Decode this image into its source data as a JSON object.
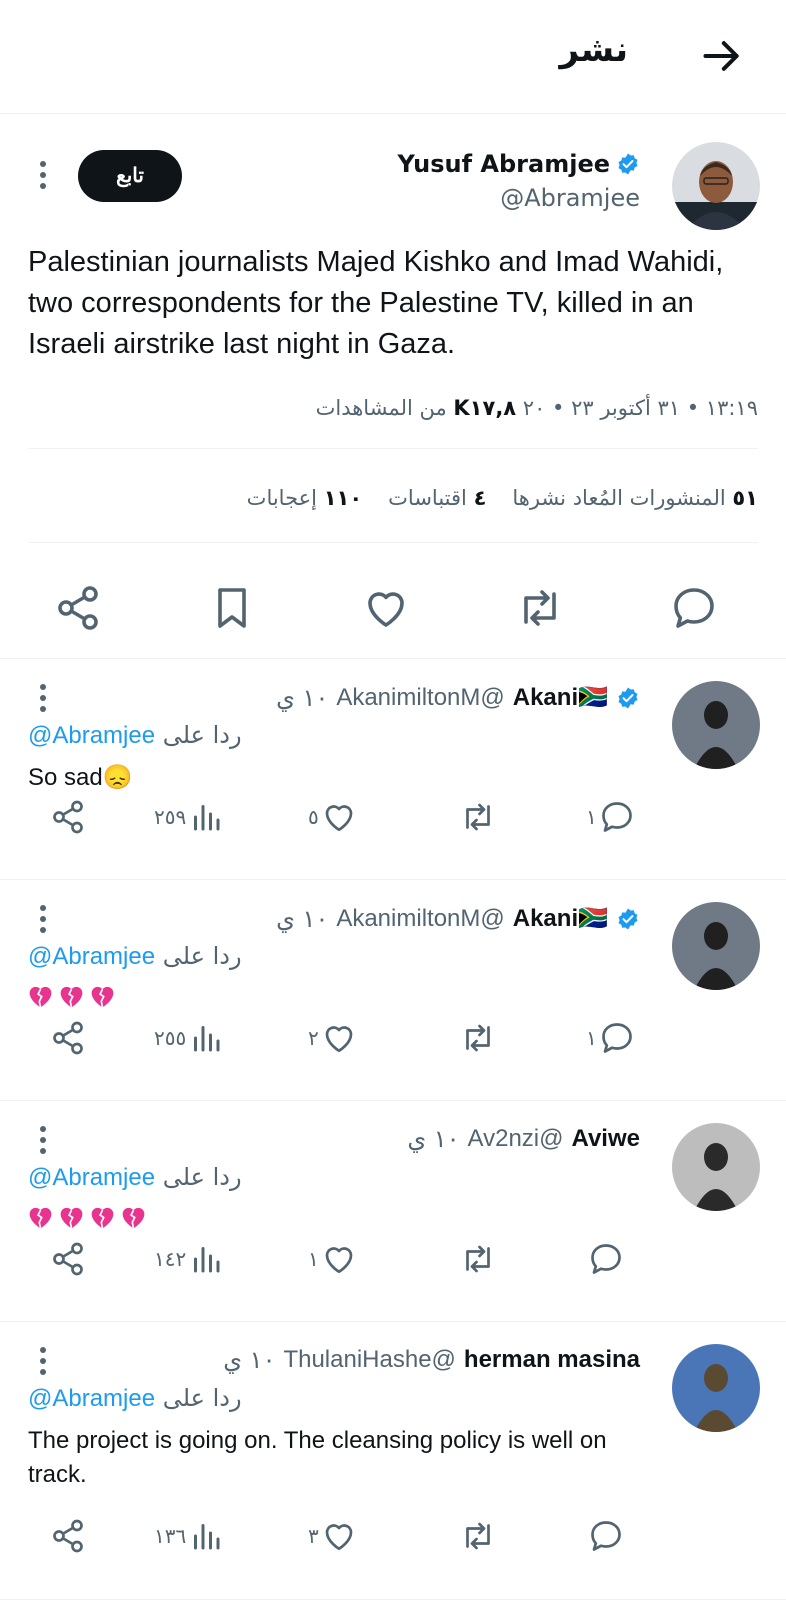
{
  "header": {
    "title": "نشر",
    "back_icon": "arrow-right-icon"
  },
  "tweet": {
    "author_name": "Yusuf Abramjee",
    "author_handle": "@Abramjee",
    "follow_label": "تابع",
    "text": "Palestinian journalists Majed Kishko and Imad Wahidi, two correspondents for the Palestine TV, killed in an Israeli airstrike last night in Gaza.",
    "timestamp": "١٣:١٩ • ٣١ أكتوبر ٢٣ • ٢٠",
    "views_count": "K١٧,٨",
    "views_label": "من المشاهدات",
    "reposts_count": "٥١",
    "reposts_label": "المنشورات المُعاد نشرها",
    "quotes_count": "٤",
    "quotes_label": "اقتباسات",
    "likes_count": "١١٠",
    "likes_label": "إعجابات"
  },
  "replies": [
    {
      "name": "Akani🇿🇦",
      "handle": "@AkanimiltonM",
      "time": "١٠ ي",
      "reply_label": "ردا على",
      "reply_to": "@Abramjee",
      "text": "So sad😞",
      "hearts": 0,
      "replies_count": "١",
      "likes_count": "٥",
      "views_count": "٢٥٩",
      "verified": true,
      "avatar_colors": [
        "#6f7a86",
        "#202020"
      ]
    },
    {
      "name": "Akani🇿🇦",
      "handle": "@AkanimiltonM",
      "time": "١٠ ي",
      "reply_label": "ردا على",
      "reply_to": "@Abramjee",
      "text": "",
      "hearts": 3,
      "replies_count": "١",
      "likes_count": "٢",
      "views_count": "٢٥٥",
      "verified": true,
      "avatar_colors": [
        "#6f7a86",
        "#202020"
      ]
    },
    {
      "name": "Aviwe",
      "handle": "@Av2nzi",
      "time": "١٠ ي",
      "reply_label": "ردا على",
      "reply_to": "@Abramjee",
      "text": "",
      "hearts": 4,
      "replies_count": "",
      "likes_count": "١",
      "views_count": "١٤٢",
      "verified": false,
      "avatar_colors": [
        "#bdbdbd",
        "#2a2a2a"
      ]
    },
    {
      "name": "herman masina",
      "handle": "@ThulaniHashe",
      "time": "١٠ ي",
      "reply_label": "ردا على",
      "reply_to": "@Abramjee",
      "text": "The project is going on. The cleansing policy is well on track.",
      "hearts": 0,
      "replies_count": "",
      "likes_count": "٣",
      "views_count": "١٣٦",
      "verified": false,
      "avatar_colors": [
        "#4a76b8",
        "#5b4a32"
      ]
    }
  ],
  "icons": {
    "reply": "comment-icon",
    "repost": "repost-icon",
    "like": "heart-icon",
    "bookmark": "bookmark-icon",
    "share": "share-icon",
    "views": "views-chart-icon",
    "more": "more-vertical-icon",
    "verified": "verified-badge-icon"
  },
  "colors": {
    "accent": "#1d9bf0",
    "text": "#0f1419",
    "muted": "#536471",
    "broken_heart": "#e8338f"
  }
}
